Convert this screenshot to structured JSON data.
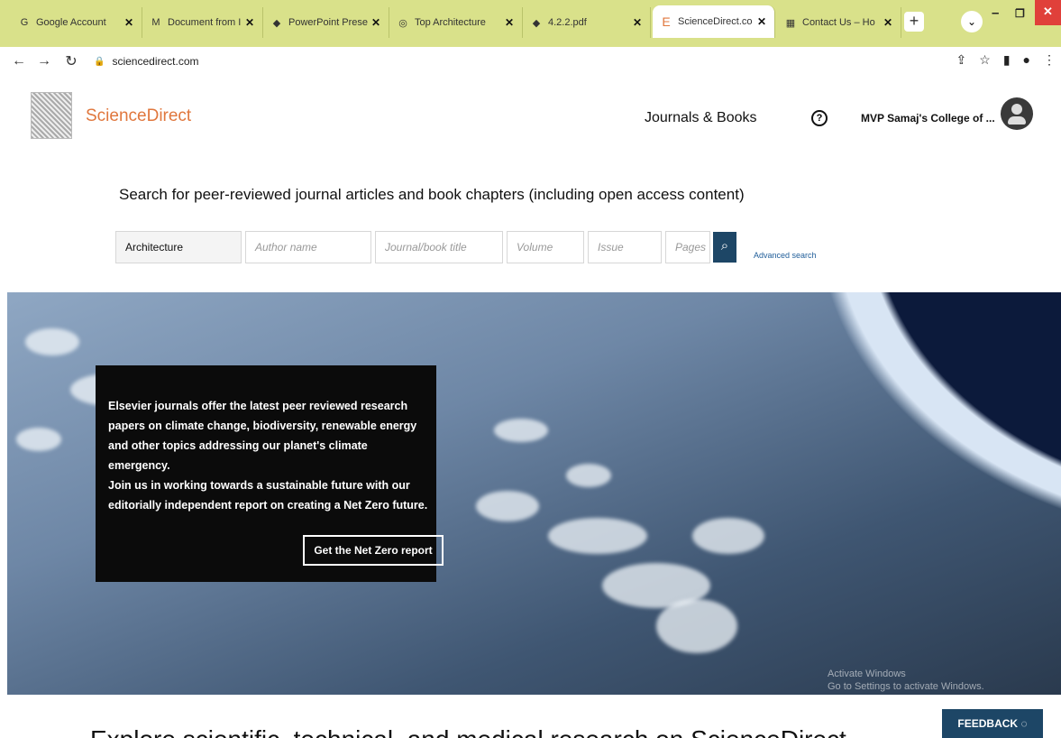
{
  "browser": {
    "tabs": [
      {
        "icon": "G",
        "label": "Google Account"
      },
      {
        "icon": "M",
        "label": "Document from I"
      },
      {
        "icon": "◆",
        "label": "PowerPoint Prese"
      },
      {
        "icon": "◎",
        "label": "Top Architecture"
      },
      {
        "icon": "◆",
        "label": "4.2.2.pdf"
      },
      {
        "icon": "E",
        "label": "ScienceDirect.co"
      },
      {
        "icon": "▦",
        "label": "Contact Us – Ho"
      }
    ],
    "new_tab": "+",
    "url": "sciencedirect.com"
  },
  "site": {
    "brand": "ScienceDirect",
    "nav_journals": "Journals & Books",
    "help": "?",
    "institution": "MVP Samaj's College of ..."
  },
  "search": {
    "title": "Search for peer-reviewed journal articles and book chapters (including open access content)",
    "keywords_value": "Architecture",
    "author_placeholder": "Author name",
    "journal_placeholder": "Journal/book title",
    "volume_placeholder": "Volume",
    "issue_placeholder": "Issue",
    "pages_placeholder": "Pages",
    "advanced": "Advanced search"
  },
  "promo": {
    "text1": "Elsevier journals offer the latest peer reviewed research papers on climate change, biodiversity, renewable energy and other topics addressing our planet's climate emergency.",
    "text2": "Join us in working towards a sustainable future with our editorially independent report on creating a Net Zero future.",
    "button": "Get the Net Zero report"
  },
  "watermark": {
    "line1": "Activate Windows",
    "line2": "Go to Settings to activate Windows."
  },
  "footer_heading": "Explore scientific, technical, and medical research on ScienceDirect",
  "feedback": "FEEDBACK"
}
